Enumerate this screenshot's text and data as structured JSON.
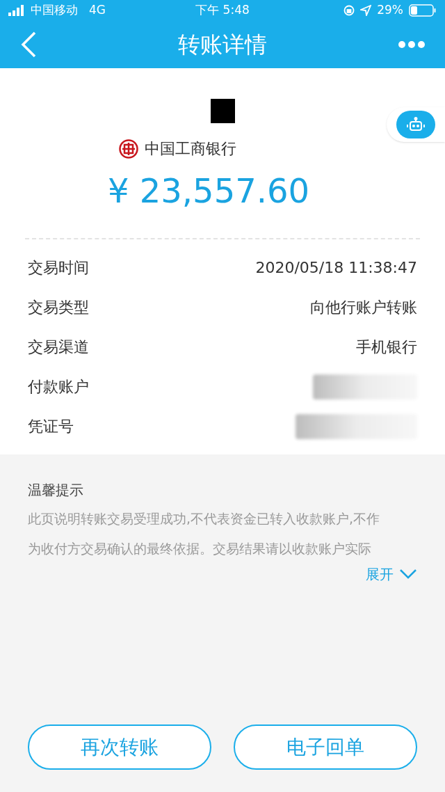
{
  "status_bar": {
    "carrier": "中国移动",
    "network": "4G",
    "time": "下午 5:48",
    "battery": "29%"
  },
  "header": {
    "title": "转账详情"
  },
  "summary": {
    "bank": "中国工商银行",
    "amount": "¥ 23,557.60"
  },
  "details": [
    {
      "label": "交易时间",
      "value": "2020/05/18 11:38:47",
      "kind": "text"
    },
    {
      "label": "交易类型",
      "value": "向他行账户转账",
      "kind": "text"
    },
    {
      "label": "交易渠道",
      "value": "手机银行",
      "kind": "text"
    },
    {
      "label": "付款账户",
      "kind": "redacted"
    },
    {
      "label": "凭证号",
      "kind": "redacted"
    }
  ],
  "tips": {
    "title": "温馨提示",
    "lines": [
      "此页说明转账交易受理成功,不代表资金已转入收款账户,不作",
      "为收付方交易确认的最终依据。交易结果请以收款账户实际"
    ],
    "expand": "展开"
  },
  "buttons": [
    "再次转账",
    "电子回单"
  ]
}
